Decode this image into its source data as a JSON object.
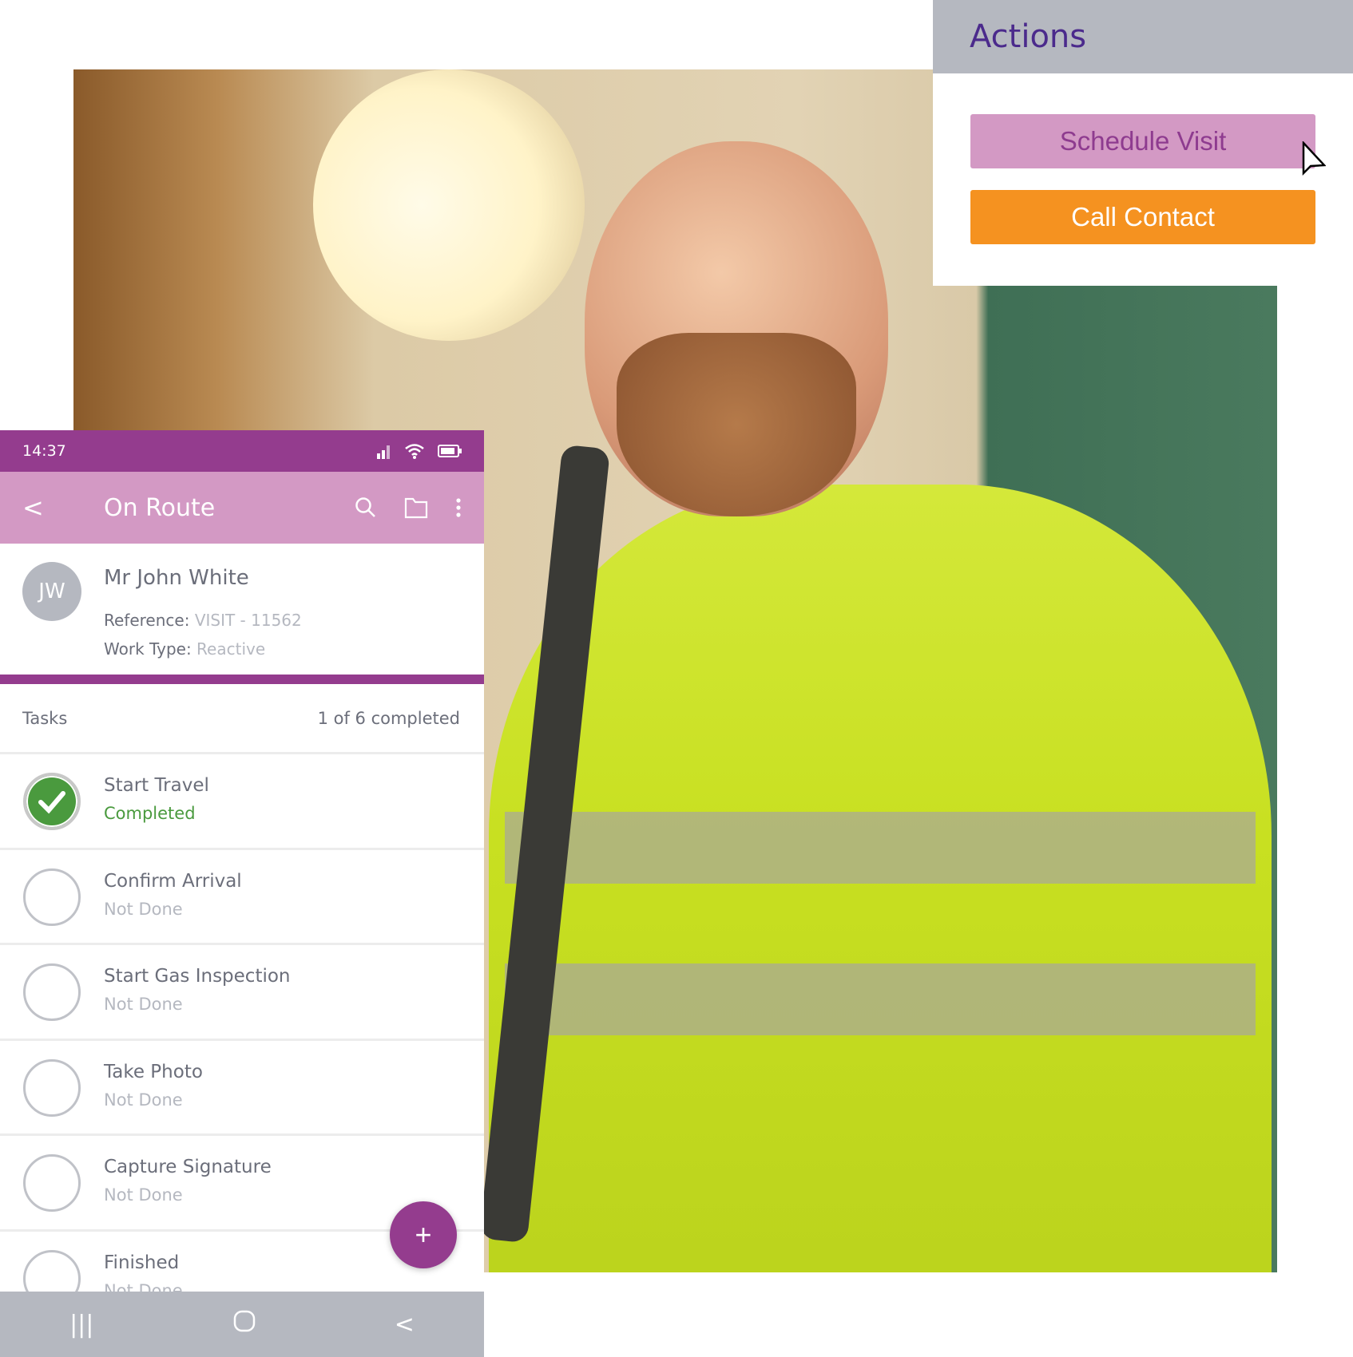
{
  "actions": {
    "title": "Actions",
    "schedule_visit": "Schedule Visit",
    "call_contact": "Call Contact"
  },
  "colors": {
    "primary": "#943c8e",
    "primary_light": "#d399c4",
    "accent": "#f59220",
    "success": "#4a9a3e",
    "gray": "#b5b8c0",
    "title": "#4b2a8c"
  },
  "phone": {
    "status_time": "14:37",
    "toolbar": {
      "back": "<",
      "title": "On Route",
      "icons": [
        "search-icon",
        "folder-icon",
        "more-vertical-icon"
      ]
    },
    "contact": {
      "initials": "JW",
      "name": "Mr John White",
      "reference_label": "Reference:",
      "reference": "VISIT - 11562",
      "work_type_label": "Work Type:",
      "work_type": "Reactive"
    },
    "tasks_label": "Tasks",
    "tasks_progress": "1 of 6 completed",
    "tasks": [
      {
        "name": "Start Travel",
        "status": "Completed"
      },
      {
        "name": "Confirm Arrival",
        "status": "Not Done"
      },
      {
        "name": "Start Gas Inspection",
        "status": "Not Done"
      },
      {
        "name": "Take Photo",
        "status": "Not Done"
      },
      {
        "name": "Capture Signature",
        "status": "Not Done"
      },
      {
        "name": "Finished",
        "status": "Not Done"
      }
    ],
    "fab": "+",
    "nav": {
      "recent": "|||",
      "back": "<"
    }
  }
}
